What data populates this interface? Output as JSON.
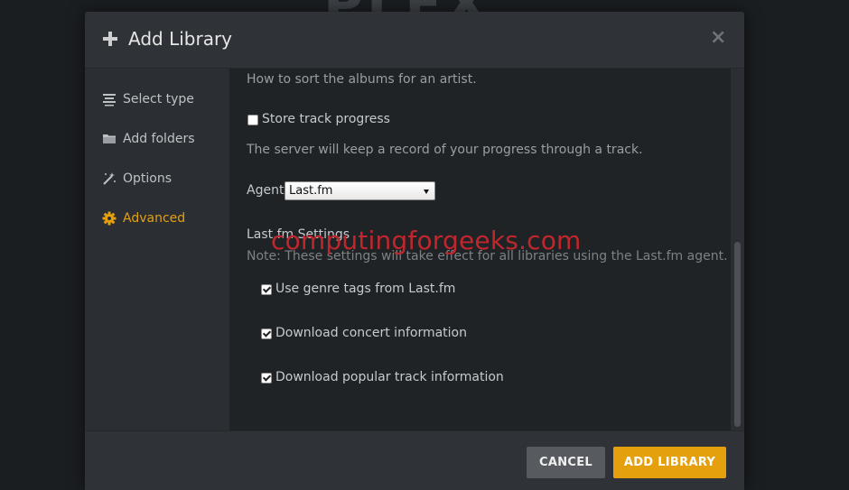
{
  "background": {
    "logo_text": "PLEX",
    "logo_accent": "X"
  },
  "colors": {
    "accent": "#e5a00d",
    "modal_bg": "#2b2f33",
    "content_bg": "#1f2326",
    "watermark": "#c0262c"
  },
  "modal": {
    "title": "Add Library",
    "close_symbol": "×"
  },
  "sidebar": {
    "items": [
      {
        "label": "Select type",
        "icon": "list-icon",
        "active": false
      },
      {
        "label": "Add folders",
        "icon": "folder-icon",
        "active": false
      },
      {
        "label": "Options",
        "icon": "magic-wand-icon",
        "active": false
      },
      {
        "label": "Advanced",
        "icon": "gear-icon",
        "active": true
      }
    ]
  },
  "content": {
    "album_sort_help": "How to sort the albums for an artist.",
    "store_track_progress": {
      "label": "Store track progress",
      "checked": false
    },
    "store_track_progress_help": "The server will keep a record of your progress through a track.",
    "agent": {
      "label": "Agent",
      "value": "Last.fm"
    },
    "lastfm_settings": {
      "heading": "Last.fm Settings",
      "note": "Note: These settings will take effect for all libraries using the Last.fm agent.",
      "options": [
        {
          "label": "Use genre tags from Last.fm",
          "checked": true
        },
        {
          "label": "Download concert information",
          "checked": true
        },
        {
          "label": "Download popular track information",
          "checked": true
        }
      ]
    }
  },
  "watermark": "computingforgeeks.com",
  "footer": {
    "cancel_label": "CANCEL",
    "add_label": "ADD LIBRARY"
  }
}
